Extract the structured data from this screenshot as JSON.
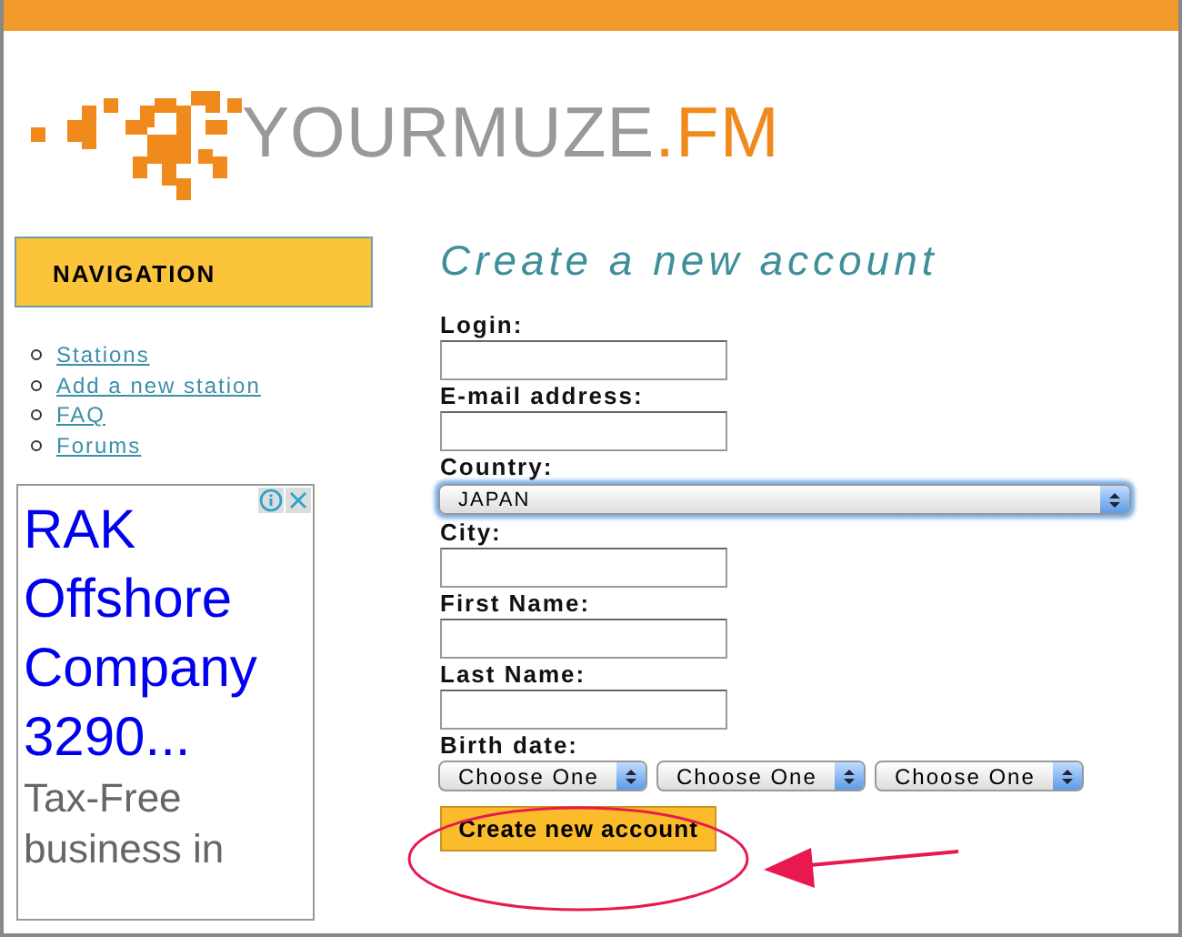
{
  "logo": {
    "name": "YOURMUZE",
    "suffix": ".FM"
  },
  "navigation": {
    "title": "NAVIGATION",
    "links": [
      "Stations",
      "Add a new station",
      "FAQ",
      "Forums"
    ]
  },
  "ad": {
    "headline": "RAK Offshore Company 3290...",
    "body": "Tax-Free business in"
  },
  "form": {
    "title": "Create a new account",
    "fields": [
      {
        "kind": "text",
        "label": "Login:"
      },
      {
        "kind": "text",
        "label": "E-mail address:"
      },
      {
        "kind": "select",
        "label": "Country:",
        "value": "JAPAN",
        "focused": true
      },
      {
        "kind": "text",
        "label": "City:"
      },
      {
        "kind": "text",
        "label": "First Name:"
      },
      {
        "kind": "text",
        "label": "Last Name:"
      },
      {
        "kind": "date",
        "label": "Birth date:",
        "parts": [
          "Choose One",
          "Choose One",
          "Choose One"
        ]
      }
    ],
    "submit": "Create new account"
  }
}
